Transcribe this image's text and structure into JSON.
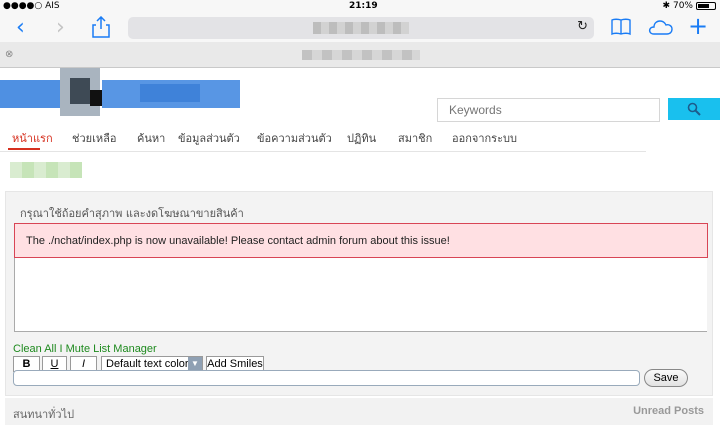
{
  "status_bar": {
    "carrier": "●●●●○ AIS",
    "time": "21:19",
    "battery": "70%",
    "battery_level": 0.7
  },
  "browser": {
    "reload_icon": "reload-icon",
    "back_icon": "chevron-left-icon",
    "forward_icon": "chevron-right-icon"
  },
  "search": {
    "placeholder": "Keywords",
    "icon": "search-icon"
  },
  "nav": {
    "items": [
      {
        "label": "หน้าแรก"
      },
      {
        "label": "ช่วยเหลือ"
      },
      {
        "label": "ค้นหา"
      },
      {
        "label": "ข้อมูลส่วนตัว"
      },
      {
        "label": "ข้อความส่วนตัว"
      },
      {
        "label": "ปฏิทิน"
      },
      {
        "label": "สมาชิก"
      },
      {
        "label": "ออกจากระบบ"
      }
    ]
  },
  "chat": {
    "title": "กรุณาใช้ถ้อยคำสุภาพ และงดโฆษณาขายสินค้า",
    "alert": "The ./nchat/index.php is now unavailable! Please contact admin forum about this issue!",
    "clear_all": "Clean All",
    "separator": "I",
    "mute_list": "Mute List Manager",
    "bold": "B",
    "underline": "U",
    "italic": "I",
    "color_select": "Default text color",
    "add_smiles": "Add Smiles",
    "save": "Save"
  },
  "footer": {
    "left": "สนทนาทั่วไป",
    "right": "Unread Posts"
  }
}
